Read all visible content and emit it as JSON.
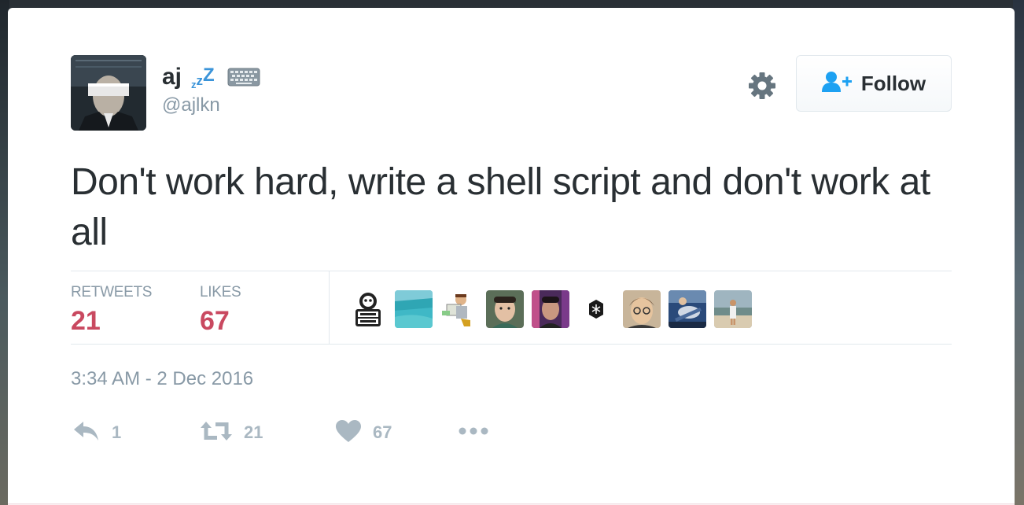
{
  "user": {
    "display_name": "aj",
    "handle": "@ajlkn"
  },
  "follow_button": {
    "label": "Follow"
  },
  "tweet": {
    "text": "Don't work hard, write a shell script and don't work at all",
    "timestamp": "3:34 AM - 2 Dec 2016"
  },
  "stats": {
    "retweets_label": "RETWEETS",
    "retweets_value": "21",
    "likes_label": "LIKES",
    "likes_value": "67"
  },
  "actions": {
    "reply_count": "1",
    "retweet_count": "21",
    "like_count": "67"
  },
  "icons": [
    "zzz-emoji-icon",
    "keyboard-icon",
    "gear-icon",
    "follow-person-icon",
    "reply-icon",
    "retweet-icon",
    "heart-icon",
    "more-icon"
  ],
  "colors": {
    "name_text": "#292f33",
    "handle_text": "#8899a6",
    "stat_value": "#c94960",
    "accent_blue": "#3b94d9",
    "action_grey": "#aab8c2",
    "divider": "#e1e8ed"
  }
}
